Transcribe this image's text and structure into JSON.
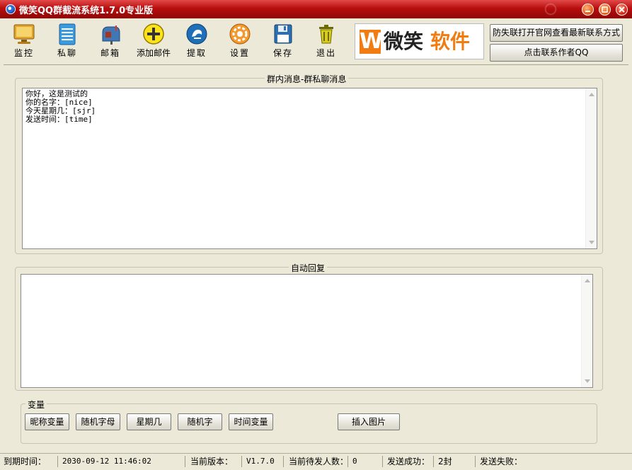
{
  "window": {
    "title": "微笑QQ群截流系统1.7.0专业版"
  },
  "toolbar": {
    "items": [
      {
        "label": "监控",
        "icon": "monitor-icon"
      },
      {
        "label": "私聊",
        "icon": "notepad-icon"
      },
      {
        "label": "邮箱",
        "icon": "mailbox-icon"
      },
      {
        "label": "添加邮件",
        "icon": "add-circle-icon"
      },
      {
        "label": "提取",
        "icon": "extract-icon"
      },
      {
        "label": "设置",
        "icon": "gear-icon"
      },
      {
        "label": "保存",
        "icon": "floppy-disk-icon"
      },
      {
        "label": "退出",
        "icon": "trash-can-icon"
      }
    ]
  },
  "brand": {
    "w": "W",
    "text_a": "微笑",
    "text_b": "软件"
  },
  "links": {
    "contact_official": "防失联打开官网查看最新联系方式",
    "contact_author": "点击联系作者QQ"
  },
  "group_message": {
    "legend": "群内消息-群私聊消息",
    "content": "你好，这是测试的\n你的名字：[nice]\n今天星期几：[sjr]\n发送时间：[time]"
  },
  "auto_reply": {
    "legend": "自动回复",
    "content": ""
  },
  "variables": {
    "legend": "变量",
    "buttons": [
      "昵称变量",
      "随机字母",
      "星期几",
      "随机字",
      "时间变量"
    ],
    "insert_image": "插入图片"
  },
  "status": {
    "expire_label": "到期时间：",
    "expire_value": "2030-09-12 11:46:02",
    "version_label": "当前版本：",
    "version_value": "V1.7.0",
    "pending_label": "当前待发人数：",
    "pending_value": "0",
    "success_label": "发送成功：",
    "success_value": "2封",
    "fail_label": "发送失败：",
    "fail_value": ""
  },
  "colors": {
    "titlebar": "#b80e0e",
    "brand_orange": "#f07c12",
    "window_bg": "#ece9d8"
  }
}
